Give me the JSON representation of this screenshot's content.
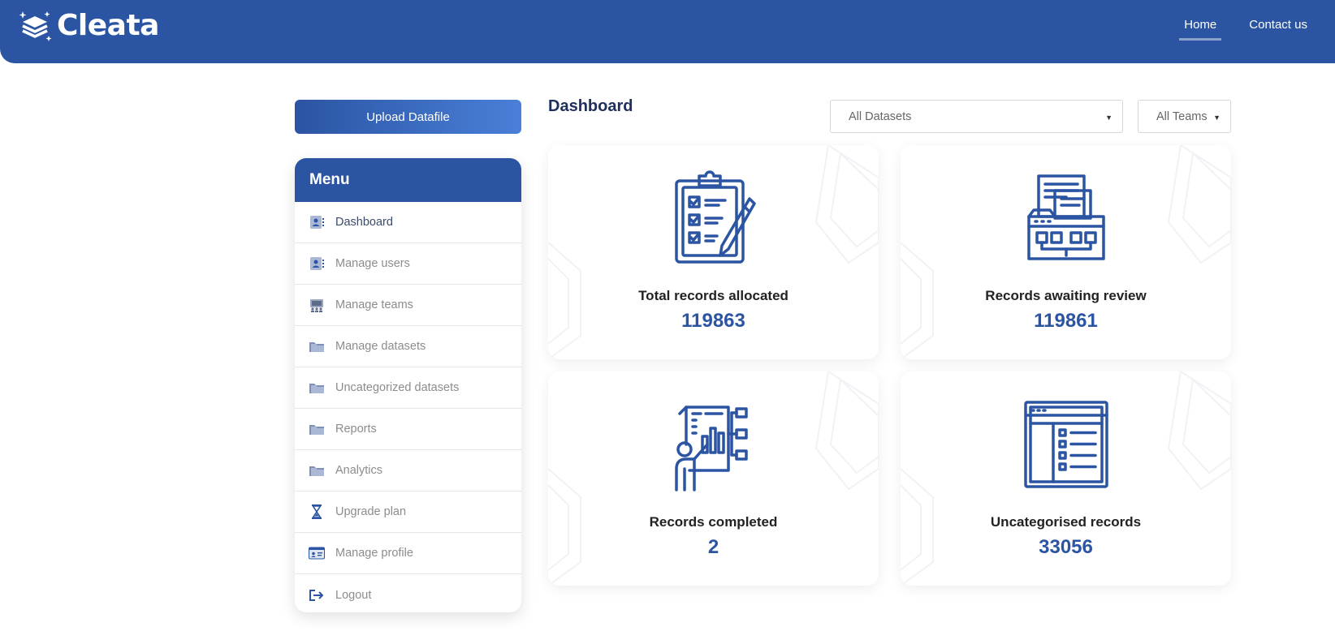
{
  "app": {
    "name": "Cleata"
  },
  "nav": {
    "home": "Home",
    "contact": "Contact us"
  },
  "upload_button": "Upload Datafile",
  "menu": {
    "title": "Menu",
    "items": [
      {
        "label": "Dashboard",
        "icon": "user-card-icon"
      },
      {
        "label": "Manage users",
        "icon": "user-card-icon"
      },
      {
        "label": "Manage teams",
        "icon": "team-monitor-icon"
      },
      {
        "label": "Manage datasets",
        "icon": "folder-icon"
      },
      {
        "label": "Uncategorized datasets",
        "icon": "folder-icon"
      },
      {
        "label": "Reports",
        "icon": "folder-icon"
      },
      {
        "label": "Analytics",
        "icon": "folder-icon"
      },
      {
        "label": "Upgrade plan",
        "icon": "hourglass-icon"
      },
      {
        "label": "Manage profile",
        "icon": "id-card-icon"
      },
      {
        "label": "Logout",
        "icon": "logout-icon"
      }
    ]
  },
  "dashboard": {
    "title": "Dashboard",
    "filters": {
      "datasets": "All Datasets",
      "teams": "All Teams"
    },
    "cards": [
      {
        "label": "Total records allocated",
        "value": "119863",
        "icon": "clipboard-checklist-icon"
      },
      {
        "label": "Records awaiting review",
        "value": "119861",
        "icon": "folder-documents-icon"
      },
      {
        "label": "Records completed",
        "value": "2",
        "icon": "presenter-chart-icon"
      },
      {
        "label": "Uncategorised records",
        "value": "33056",
        "icon": "browser-list-icon"
      }
    ]
  },
  "colors": {
    "brand": "#2b55a3",
    "value": "#2b55a3",
    "title": "#1f2f5c"
  }
}
